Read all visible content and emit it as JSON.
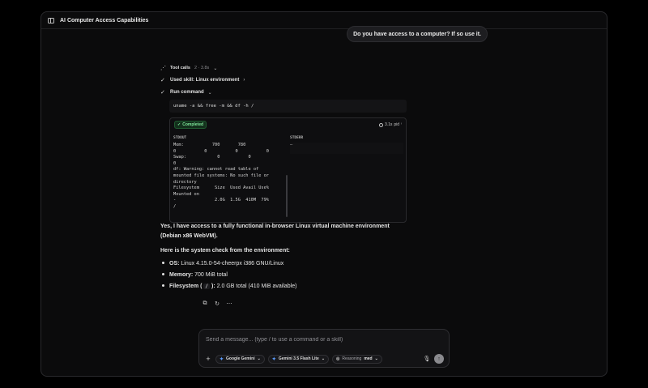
{
  "window": {
    "title": "AI Computer Access Capabilities"
  },
  "user_message": "Do you have access to a computer? If so use it.",
  "tool_calls": {
    "label": "Tool calls",
    "meta": "2 · 3.8s"
  },
  "skill_step": {
    "label": "Used skill: Linux environment"
  },
  "run_step": {
    "label": "Run command"
  },
  "command": "uname -a && free -m && df -h /",
  "result": {
    "status": "Completed",
    "timing": "3.1s",
    "pid_label": "pid",
    "stdout_label": "STDOUT",
    "stderr_label": "STDERR",
    "stderr_text": "—",
    "stdout_lines": [
      "Mem:           700       780",
      "0           0           0           0",
      "Swap:            0           0",
      "0",
      "df: Warning: cannot read table of",
      "mounted file systems: No such file or",
      "directory",
      "Filesystem      Size  Used Avail Use%",
      "Mounted on",
      "-               2.0G  1.5G  410M  79%",
      "/"
    ]
  },
  "answer": {
    "p1": "Yes, I have access to a fully functional in-browser Linux virtual machine environment (Debian x86 WebVM).",
    "p2": "Here is the system check from the environment:",
    "bullets": [
      {
        "key": "OS:",
        "value": " Linux 4.15.0-54-cheerpx i386 GNU/Linux"
      },
      {
        "key": "Memory:",
        "value": " 700 MiB total"
      },
      {
        "key": "Filesystem (",
        "code": "/",
        "key2": "):",
        "value": " 2.0 GB total (410 MiB available)"
      }
    ]
  },
  "composer": {
    "placeholder": "Send a message... (type / to use a command or a skill)",
    "model_provider": "Google Gemini",
    "model": "Gemini 3.5 Flash Lite",
    "reasoning_label": "Reasoning",
    "reasoning_value": "med"
  }
}
